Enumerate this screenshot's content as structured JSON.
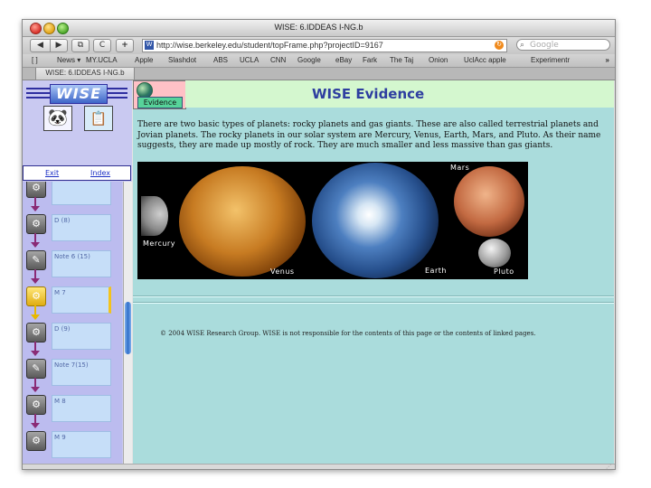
{
  "window": {
    "title": "WISE: 6.IDDEAS I-NG.b"
  },
  "toolbar": {
    "back_icon": "◀",
    "forward_icon": "▶",
    "tab_icon": "⧉",
    "reload_icon": "C",
    "add_icon": "+",
    "url": "http://wise.berkeley.edu/student/topFrame.php?projectID=9167",
    "search_placeholder": "Google"
  },
  "bookmarks": [
    "[ ]",
    "News ▾",
    "MY.UCLA",
    "Apple",
    "Slashdot",
    "ABS",
    "UCLA",
    "CNN",
    "Google",
    "eBay",
    "Fark",
    "The Taj",
    "Onion",
    "UclAcc apple",
    "Experimentr"
  ],
  "bookmarks_more": "»",
  "tab": {
    "label": "WISE: 6.IDDEAS I-NG.b"
  },
  "sidebar": {
    "logo": "WISE",
    "exit_label": "Exit",
    "index_label": "Index",
    "steps": [
      {
        "label": "",
        "icon": "⚙"
      },
      {
        "label": "D (8)",
        "icon": "⚙"
      },
      {
        "label": "Note 6 (15)",
        "icon": "✎"
      },
      {
        "label": "M 7",
        "icon": "⚙",
        "active": true
      },
      {
        "label": "D (9)",
        "icon": "⚙"
      },
      {
        "label": "Note 7(15)",
        "icon": "✎"
      },
      {
        "label": "M 8",
        "icon": "⚙"
      },
      {
        "label": "M 9",
        "icon": "⚙"
      }
    ]
  },
  "content": {
    "tab_label": "Evidence",
    "title": "WISE Evidence",
    "paragraph": "There are two basic types of planets: rocky planets and gas giants. These are also called terrestrial planets and Jovian planets. The rocky planets in our solar system are Mercury, Venus, Earth, Mars, and Pluto. As their name suggests, they are made up mostly of rock. They are much smaller and less massive than gas giants.",
    "planets": {
      "mercury": "Mercury",
      "venus": "Venus",
      "earth": "Earth",
      "mars": "Mars",
      "pluto": "Pluto"
    },
    "footer": "© 2004 WISE Research Group. WISE is not responsible for the contents of this page or the contents of linked pages."
  },
  "colors": {
    "sidebar_bg": "#c9c9f1",
    "content_bg": "#aadcdc",
    "banner_bg": "#d4f7cf",
    "title_blue": "#2e3ea0",
    "active_yellow": "#f3c31c"
  }
}
